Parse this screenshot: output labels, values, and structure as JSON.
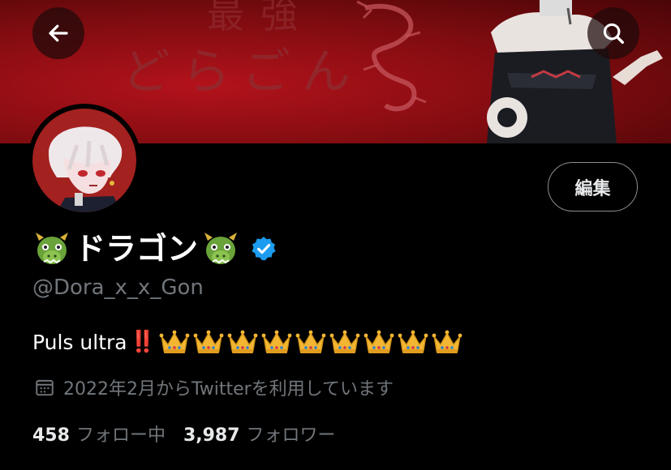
{
  "banner": {
    "text_main": "どらごん",
    "text_top": "最強"
  },
  "header": {
    "back_icon": "back-arrow-icon",
    "search_icon": "search-icon"
  },
  "profile": {
    "display_name": "ドラゴン",
    "name_emoji": "dragon-face-emoji",
    "verified_icon": "verified-badge-icon",
    "handle": "@Dora_x_x_Gon",
    "edit_label": "編集",
    "bio_text": "Puls ultra",
    "bio_mark": "‼️",
    "bio_crown_count": 9,
    "joined": "2022年2月からTwitterを利用しています",
    "following_count": "458",
    "following_label": "フォロー中",
    "followers_count": "3,987",
    "followers_label": "フォロワー"
  },
  "colors": {
    "background": "#000000",
    "banner_red": "#a0121a",
    "secondary_text": "#71767b",
    "verified_blue": "#1d9bf0",
    "bang_red": "#e0245e"
  }
}
